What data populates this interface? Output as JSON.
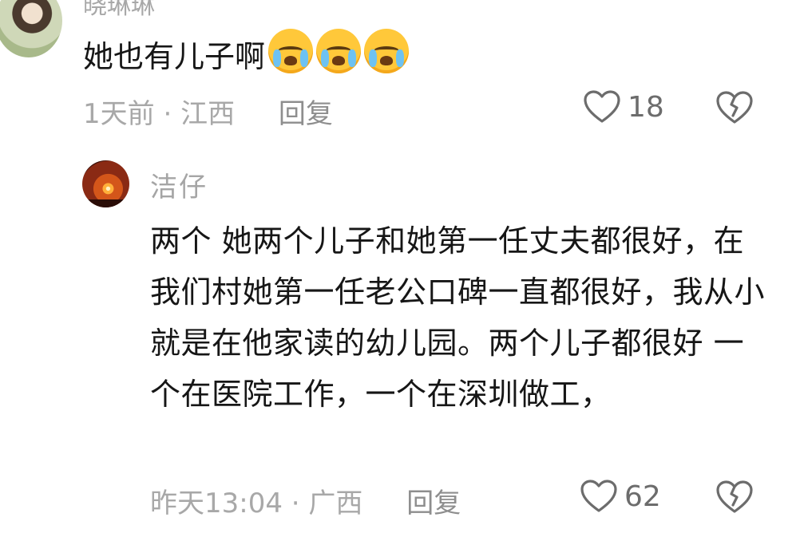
{
  "comments": [
    {
      "username": "晓琳琳",
      "text": "她也有儿子啊",
      "emojis": [
        "crying-face-emoji",
        "crying-face-emoji",
        "crying-face-emoji"
      ],
      "time": "1天前",
      "separator": " · ",
      "location": "江西",
      "reply_label": "回复",
      "likes": "18"
    },
    {
      "username": "洁仔",
      "text": "两个 她两个儿子和她第一任丈夫都很好，在我们村她第一任老公口碑一直都很好，我从小就是在他家读的幼儿园。两个儿子都很好 一个在医院工作，一个在深圳做工，",
      "time": "昨天13:04",
      "separator": " · ",
      "location": "广西",
      "reply_label": "回复",
      "likes": "62"
    }
  ],
  "colors": {
    "text": "#161616",
    "meta": "#a8a8a8",
    "icon": "#6c6c6c"
  }
}
